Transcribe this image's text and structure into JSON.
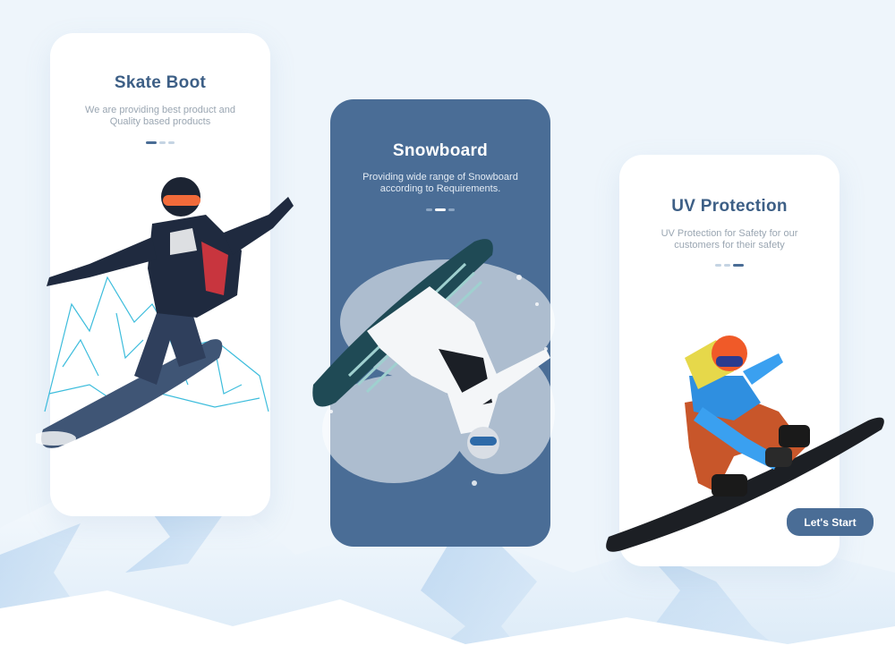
{
  "cards": [
    {
      "title": "Skate Boot",
      "description": "We are providing best product and Quality based products",
      "active_dot": 0
    },
    {
      "title": "Snowboard",
      "description": "Providing wide range of Snowboard according to Requirements.",
      "active_dot": 1
    },
    {
      "title": "UV Protection",
      "description": "UV Protection for Safety for our customers for their safety",
      "active_dot": 2
    }
  ],
  "cta": {
    "label": "Let's Start"
  },
  "colors": {
    "accent": "#4a6d96",
    "title": "#3d5f86",
    "background": "#eef5fb",
    "text_muted": "#9aa6b2"
  },
  "icons": {
    "skater_1": "snowboarder-jumping-icon",
    "skater_2": "snowboarder-flip-icon",
    "skater_3": "snowboarder-crouch-icon"
  }
}
